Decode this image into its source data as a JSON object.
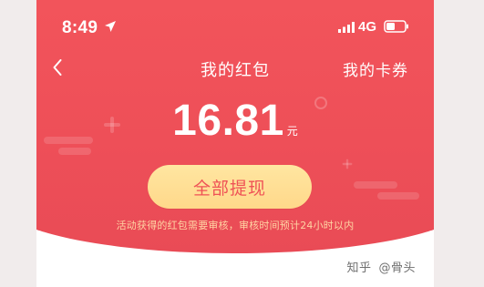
{
  "status_bar": {
    "time": "8:49",
    "network": "4G",
    "icons": {
      "location": "location-arrow-icon",
      "signal": "signal-bars-icon",
      "battery": "battery-icon"
    }
  },
  "header": {
    "back_icon": "chevron-left-icon",
    "title": "我的红包",
    "right_link": "我的卡券"
  },
  "balance": {
    "amount": "16.81",
    "unit": "元"
  },
  "actions": {
    "withdraw_label": "全部提现"
  },
  "notice": "活动获得的红包需要审核，审核时间预计24小时以内",
  "watermark": {
    "site": "知乎",
    "author": "@骨头"
  },
  "colors": {
    "header_red": "#f2545b",
    "button_gold": "#ffe29a",
    "button_text": "#ef5256",
    "notice_text": "#ffd4a3",
    "background": "#ffffff"
  }
}
